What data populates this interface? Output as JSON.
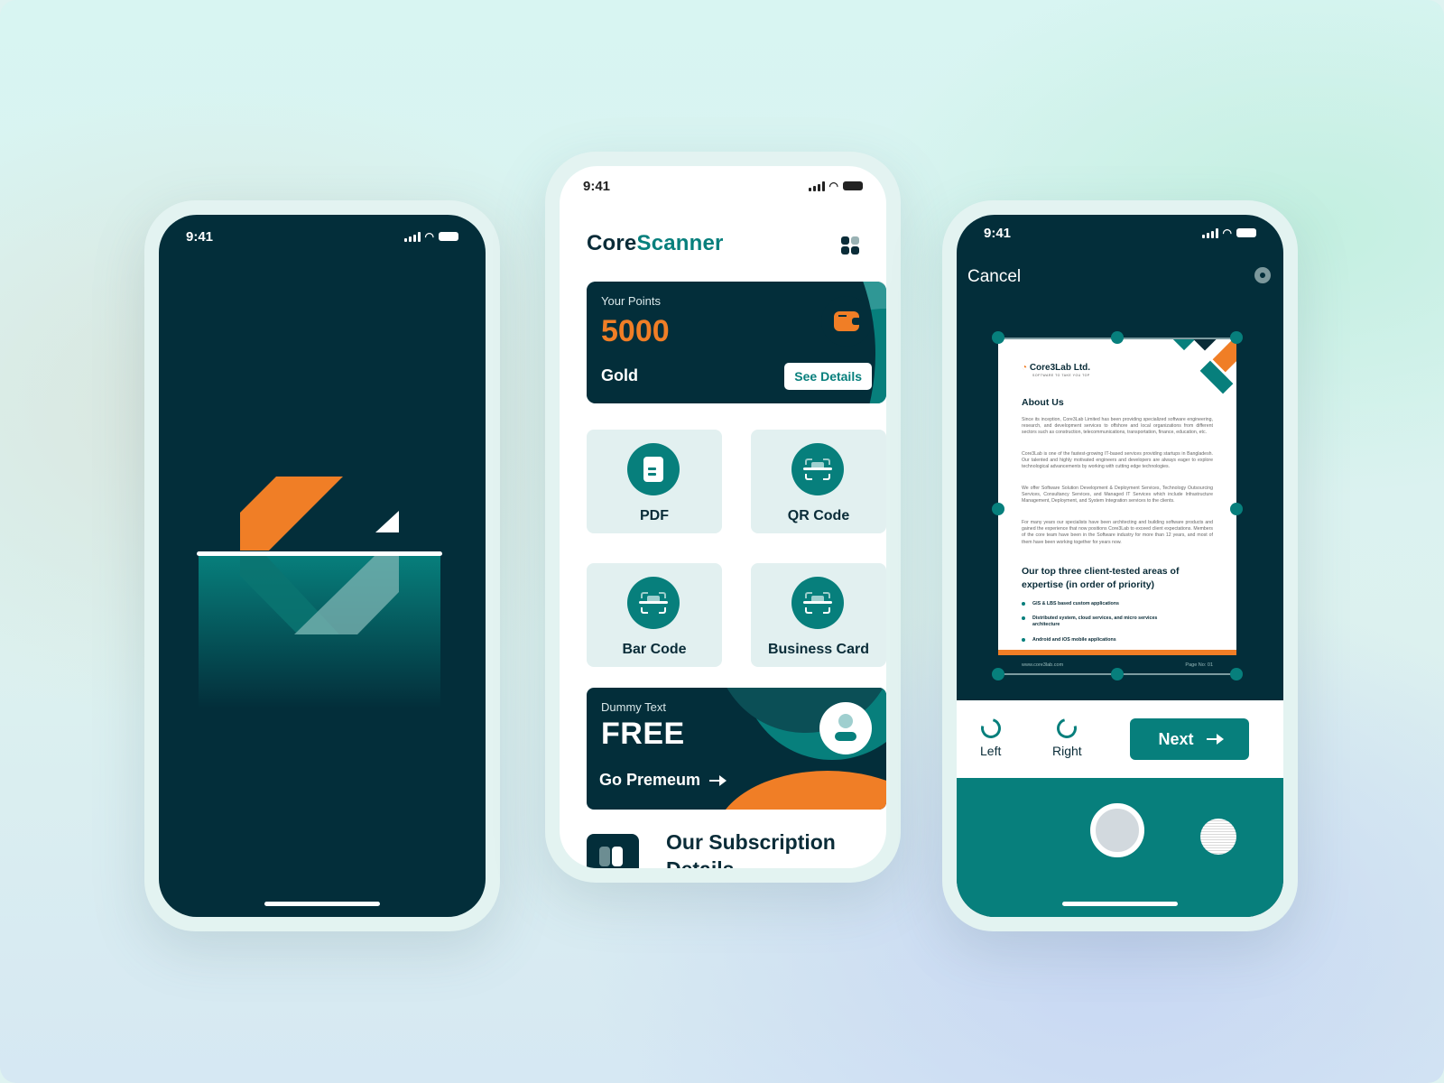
{
  "colors": {
    "dark": "#032e3a",
    "teal": "#077f7c",
    "orange": "#f07e26",
    "tile": "#e2f0f0"
  },
  "splash": {
    "time": "9:41"
  },
  "home": {
    "time": "9:41",
    "brand_part1": "Core",
    "brand_part2": "Scanner",
    "points": {
      "label": "Your Points",
      "value": "5000",
      "tier": "Gold",
      "button": "See Details"
    },
    "tiles": [
      {
        "label": "PDF",
        "icon": "document-icon"
      },
      {
        "label": "QR Code",
        "icon": "scan-icon"
      },
      {
        "label": "Bar Code",
        "icon": "scan-icon"
      },
      {
        "label": "Business Card",
        "icon": "scan-icon"
      }
    ],
    "promo": {
      "label": "Dummy Text",
      "title": "FREE",
      "cta": "Go Premeum"
    },
    "subscription": {
      "title": "Our Subscription Details"
    }
  },
  "scanner": {
    "time": "9:41",
    "cancel": "Cancel",
    "doc": {
      "company": "Core3Lab Ltd.",
      "tagline": "SOFTWARE TO TAKE YOU TOP",
      "heading": "About Us",
      "paragraphs": [
        "Since its inception, Core3Lab Limited has been providing specialized software engineering, research, and development services to offshore and local organizations from different sectors such as construction, telecommunications, transportation, finance, education, etc.",
        "Core3Lab is one of the fastest-growing IT-based services providing startups in Bangladesh. Our talented and highly motivated engineers and developers are always eager to explore technological advancements by working with cutting edge technologies.",
        "We offer Software Solution Development & Deployment Services, Technology Outsourcing Services, Consultancy Services, and Managed IT Services which include Infrastructure Management, Deployment, and System Integration services to the clients.",
        "For many years our specialists have been architecting and building software products and gained the experience that now positions Core3Lab to exceed client expectations. Members of the core team have been in the Software industry for more than 12 years, and most of them have been working together for years now."
      ],
      "subheading": "Our top three client-tested areas of expertise (in order of priority)",
      "bullets": [
        "GIS & LBS based custom applications",
        "Distributed system, cloud services, and micro services architecture",
        "Android and iOS mobile applications"
      ],
      "footer_url": "www.core3lab.com",
      "footer_page": "Page No: 01"
    },
    "rotate_left": "Left",
    "rotate_right": "Right",
    "next": "Next"
  }
}
